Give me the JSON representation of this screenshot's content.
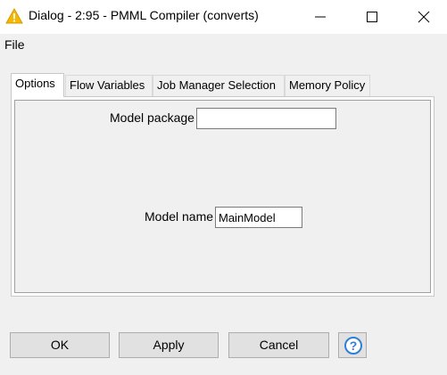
{
  "window": {
    "title": "Dialog - 2:95 - PMML Compiler (converts)",
    "icon": "warning-triangle-icon",
    "controls": [
      "minimize-icon",
      "maximize-icon",
      "close-icon"
    ]
  },
  "menu": {
    "items": [
      {
        "label": "File"
      }
    ]
  },
  "tabs": [
    {
      "label": "Options",
      "active": true
    },
    {
      "label": "Flow Variables",
      "active": false
    },
    {
      "label": "Job Manager Selection",
      "active": false
    },
    {
      "label": "Memory Policy",
      "active": false
    }
  ],
  "options": {
    "model_package": {
      "label": "Model package",
      "value": ""
    },
    "model_name": {
      "label": "Model name",
      "value": "MainModel"
    }
  },
  "buttons": {
    "ok": "OK",
    "apply": "Apply",
    "cancel": "Cancel",
    "help_icon": "help-question-icon"
  },
  "colors": {
    "warning": "#f5b800",
    "help_blue": "#2f7fd6",
    "button_face": "#e1e1e1"
  }
}
